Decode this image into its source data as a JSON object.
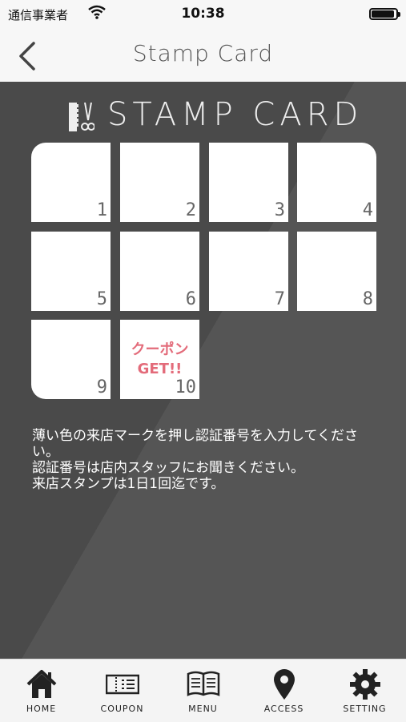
{
  "status": {
    "carrier": "通信事業者",
    "time": "10:38",
    "battery_level": 1.0
  },
  "nav": {
    "title": "Stamp Card"
  },
  "card": {
    "title": "STAMP CARD",
    "stamps": [
      {
        "number": "1",
        "reward": ""
      },
      {
        "number": "2",
        "reward": ""
      },
      {
        "number": "3",
        "reward": ""
      },
      {
        "number": "4",
        "reward": ""
      },
      {
        "number": "5",
        "reward": ""
      },
      {
        "number": "6",
        "reward": ""
      },
      {
        "number": "7",
        "reward": ""
      },
      {
        "number": "8",
        "reward": ""
      },
      {
        "number": "9",
        "reward": ""
      },
      {
        "number": "10",
        "reward_line1": "クーポン",
        "reward_line2": "GET!!"
      }
    ]
  },
  "instructions": {
    "line1": "薄い色の来店マークを押し認証番号を入力してください。",
    "line2": "認証番号は店内スタッフにお聞きください。",
    "line3": "来店スタンプは1日1回迄です。"
  },
  "tabs": [
    {
      "label": "HOME",
      "icon": "home-icon"
    },
    {
      "label": "COUPON",
      "icon": "coupon-icon"
    },
    {
      "label": "MENU",
      "icon": "menu-book-icon"
    },
    {
      "label": "ACCESS",
      "icon": "map-pin-icon"
    },
    {
      "label": "SETTING",
      "icon": "gear-icon"
    }
  ],
  "colors": {
    "card_bg": "#4a4a4a",
    "reward_text": "#e36b7a",
    "bars": "#f7f7f7"
  }
}
